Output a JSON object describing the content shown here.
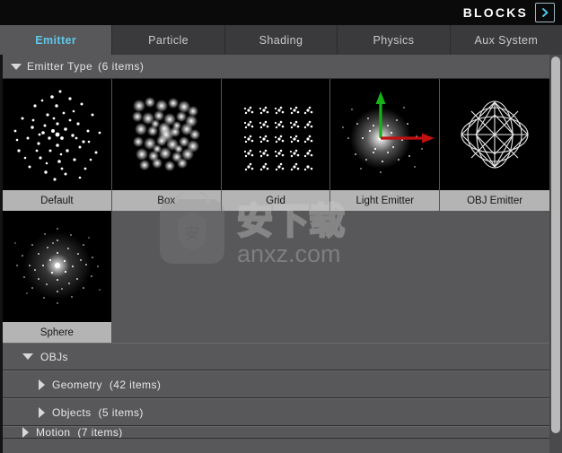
{
  "header": {
    "brand": "BLOCKS",
    "expand_icon": "chevron-right-icon"
  },
  "tabs": [
    {
      "label": "Emitter",
      "active": true
    },
    {
      "label": "Particle",
      "active": false
    },
    {
      "label": "Shading",
      "active": false
    },
    {
      "label": "Physics",
      "active": false
    },
    {
      "label": "Aux System",
      "active": false
    }
  ],
  "sections": {
    "emitter_type": {
      "label": "Emitter Type",
      "count_label": "(6 items)",
      "expanded": true,
      "disclosure_icon": "triangle-down-icon",
      "items": [
        {
          "label": "Default",
          "art": "scatter-cloud"
        },
        {
          "label": "Box",
          "art": "box-cloud"
        },
        {
          "label": "Grid",
          "art": "grid-clusters"
        },
        {
          "label": "Light Emitter",
          "art": "axis-burst"
        },
        {
          "label": "OBJ Emitter",
          "art": "wireframe-octahedron"
        },
        {
          "label": "Sphere",
          "art": "radial-burst"
        }
      ]
    }
  },
  "tree": [
    {
      "label": "OBJs",
      "count_label": "",
      "expanded": true,
      "indent": 1,
      "disclosure_icon": "triangle-down-icon"
    },
    {
      "label": "Geometry",
      "count_label": "(42 items)",
      "expanded": false,
      "indent": 2,
      "disclosure_icon": "triangle-right-icon"
    },
    {
      "label": "Objects",
      "count_label": "(5 items)",
      "expanded": false,
      "indent": 2,
      "disclosure_icon": "triangle-right-icon"
    },
    {
      "label": "Motion",
      "count_label": "(7 items)",
      "expanded": false,
      "indent": 1,
      "disclosure_icon": "triangle-right-icon"
    }
  ],
  "scrollbar": {
    "orientation": "vertical",
    "name": "panel-scrollbar"
  },
  "watermark": {
    "text_cn": "安下载",
    "text_url": "anxz.com"
  },
  "colors": {
    "header_bg": "#0a0a0a",
    "panel_bg": "#58585a",
    "tab_inactive_bg": "#3a3a3c",
    "tab_active_text": "#5fc8e8",
    "thumb_label_bg": "#b4b4b4",
    "thumb_art_bg": "#000000",
    "axis_green": "#18b018",
    "axis_red": "#c01010"
  }
}
